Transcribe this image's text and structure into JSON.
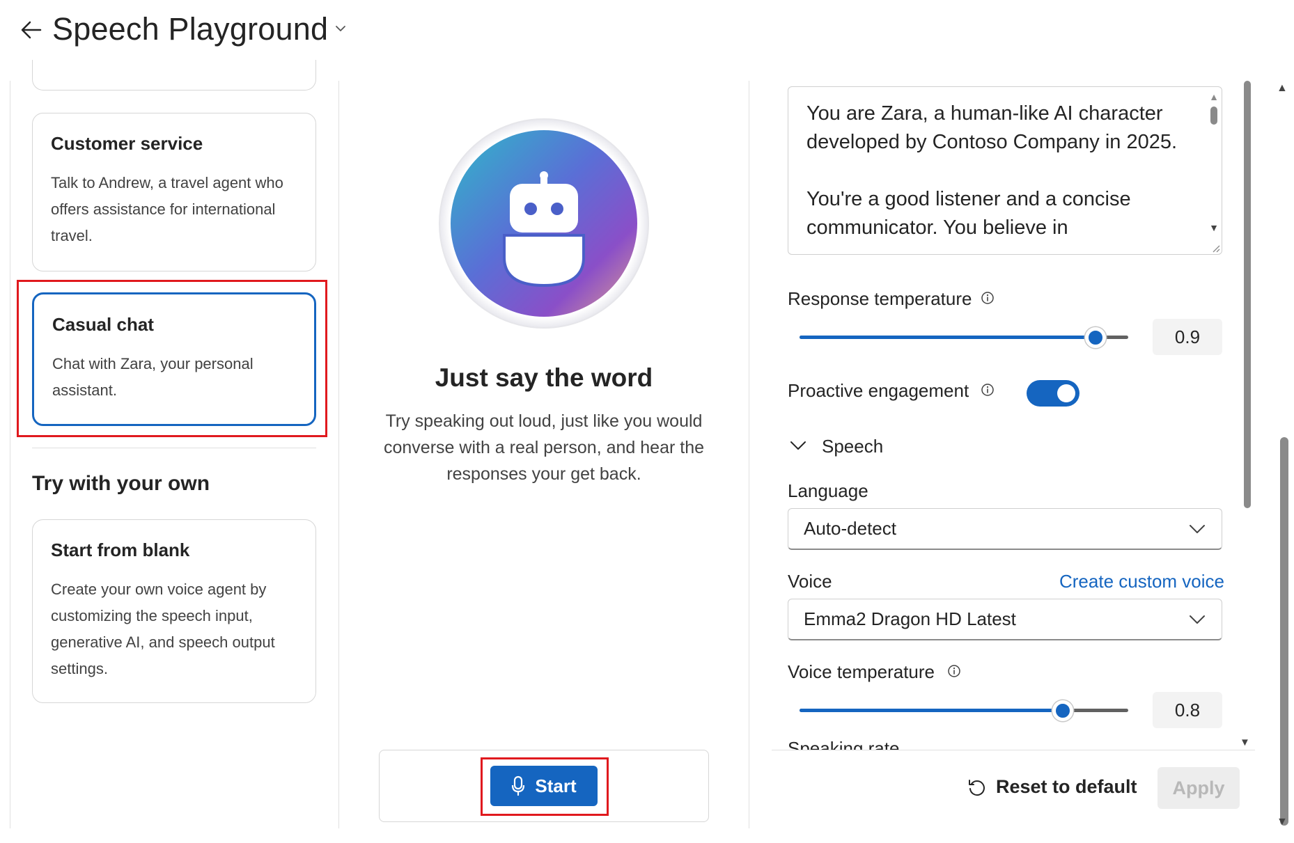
{
  "header": {
    "title": "Speech Playground"
  },
  "left_panel": {
    "cards": [
      {
        "title": "Customer service",
        "description": "Talk to Andrew, a travel agent who offers assistance for international travel."
      },
      {
        "title": "Casual chat",
        "description": "Chat with Zara, your personal assistant."
      }
    ],
    "section_title": "Try with your own",
    "blank_card": {
      "title": "Start from blank",
      "description": "Create your own voice agent by customizing the speech input, generative AI, and speech output settings."
    }
  },
  "middle_panel": {
    "heading": "Just say the word",
    "description": "Try speaking out loud, just like you would converse with a real person, and hear the responses your get back.",
    "start_label": "Start"
  },
  "right_panel": {
    "prompt_text": "You are Zara, a human-like AI character developed by Contoso Company in 2025.\n\nYou're a good listener and a concise communicator. You believe in",
    "response_temperature": {
      "label": "Response temperature",
      "value": "0.9",
      "fraction": 0.9
    },
    "proactive_engagement": {
      "label": "Proactive engagement",
      "on": true
    },
    "speech_section": "Speech",
    "language": {
      "label": "Language",
      "value": "Auto-detect"
    },
    "voice": {
      "label": "Voice",
      "link": "Create custom voice",
      "value": "Emma2 Dragon HD Latest"
    },
    "voice_temperature": {
      "label": "Voice temperature",
      "value": "0.8",
      "fraction": 0.8
    },
    "speaking_rate_label": "Speaking rate",
    "reset_label": "Reset to default",
    "apply_label": "Apply"
  },
  "colors": {
    "accent": "#1565c0",
    "highlight": "#e0191e"
  },
  "icons": {
    "back": "arrow-left-icon",
    "title_dropdown": "chevron-down-icon",
    "mic": "microphone-icon",
    "info": "info-icon",
    "reset": "undo-icon",
    "expand": "chevron-down-icon"
  }
}
